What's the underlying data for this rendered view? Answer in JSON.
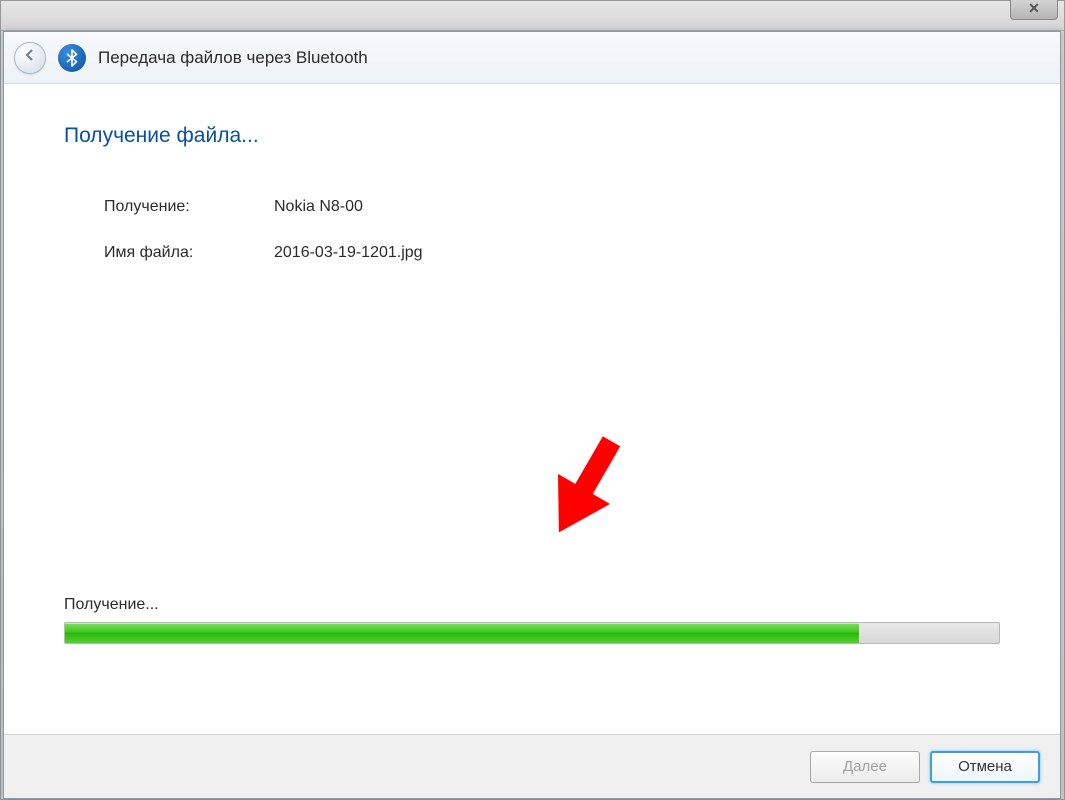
{
  "outer_window": {
    "close_glyph": "✕"
  },
  "wizard": {
    "title": "Передача файлов через Bluetooth",
    "heading": "Получение файла...",
    "info": {
      "source_label": "Получение:",
      "source_value": "Nokia N8-00",
      "filename_label": "Имя файла:",
      "filename_value": "2016-03-19-1201.jpg"
    },
    "progress": {
      "label": "Получение...",
      "percent": 85
    },
    "buttons": {
      "next": "Далее",
      "cancel": "Отмена"
    }
  },
  "colors": {
    "accent": "#0a4f9e",
    "progress_green": "#3fc91f",
    "annotation_red": "#ff0000"
  }
}
